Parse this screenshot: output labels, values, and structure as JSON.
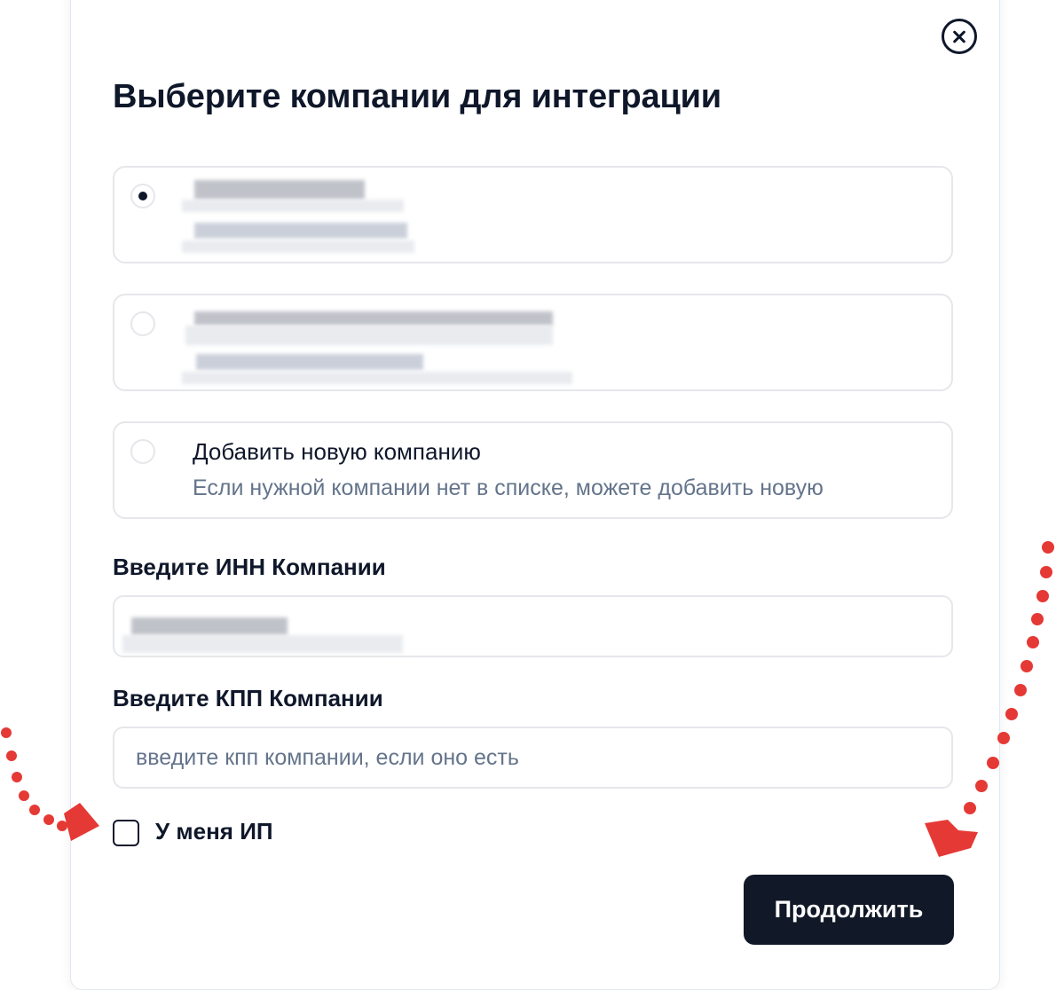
{
  "modal": {
    "title": "Выберите компании для интеграции",
    "close_icon": "close-circle-icon"
  },
  "options": [
    {
      "selected": true,
      "title": "",
      "subtitle": ""
    },
    {
      "selected": false,
      "title": "",
      "subtitle": ""
    },
    {
      "selected": false,
      "title": "Добавить новую компанию",
      "subtitle": "Если нужной компании нет в списке, можете добавить новую"
    }
  ],
  "inn": {
    "label": "Введите ИНН Компании",
    "value": ""
  },
  "kpp": {
    "label": "Введите КПП Компании",
    "placeholder": "введите кпп компании, если оно есть"
  },
  "ip_checkbox": {
    "label": "У меня ИП",
    "checked": false
  },
  "continue_button": {
    "label": "Продолжить"
  },
  "colors": {
    "primary": "#111827",
    "text": "#0f172a",
    "muted": "#64748b",
    "border": "#e5e7eb",
    "annotation": "#e53935"
  }
}
